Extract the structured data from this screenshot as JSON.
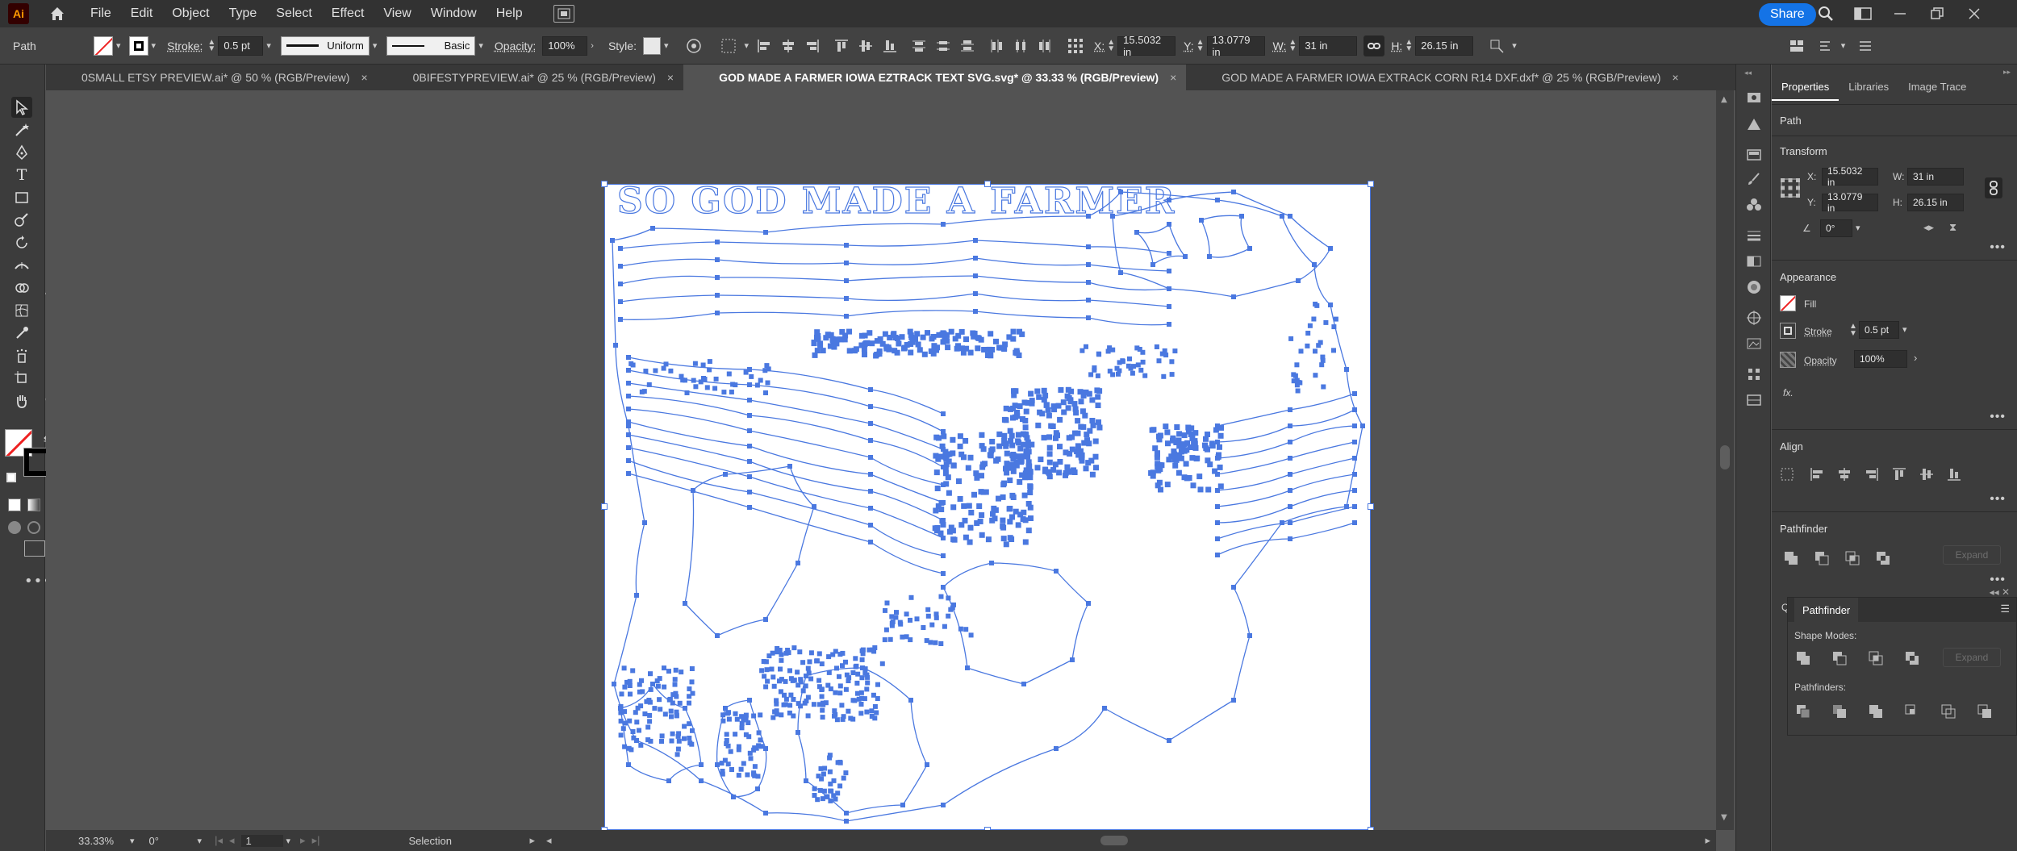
{
  "app": {
    "logo": "Ai",
    "menu": [
      "File",
      "Edit",
      "Object",
      "Type",
      "Select",
      "Effect",
      "View",
      "Window",
      "Help"
    ],
    "share_label": "Share"
  },
  "control_bar": {
    "object_type": "Path",
    "stroke_label": "Stroke:",
    "stroke_value": "0.5 pt",
    "stroke_profile": "Uniform",
    "brush": "Basic",
    "opacity_label": "Opacity:",
    "opacity_value": "100%",
    "style_label": "Style:",
    "x_label": "X:",
    "x_value": "15.5032 in",
    "y_label": "Y:",
    "y_value": "13.0779 in",
    "w_label": "W:",
    "w_value": "31 in",
    "h_label": "H:",
    "h_value": "26.15 in"
  },
  "tabs": [
    {
      "label": "0SMALL ETSY PREVIEW.ai* @ 50 % (RGB/Preview)",
      "active": false
    },
    {
      "label": "0BIFESTYPREVIEW.ai* @ 25 % (RGB/Preview)",
      "active": false
    },
    {
      "label": "GOD MADE A FARMER IOWA EZTRACK TEXT SVG.svg* @ 33.33 % (RGB/Preview)",
      "active": true
    },
    {
      "label": "GOD MADE A FARMER IOWA EXTRACK CORN R14 DXF.dxf* @ 25 % (RGB/Preview)",
      "active": false
    }
  ],
  "tab_close": "×",
  "artwork": {
    "headline": "SO GOD MADE A FARMER",
    "path_color": "#4a78e0"
  },
  "status_bar": {
    "zoom": "33.33%",
    "rotation": "0°",
    "artboard": "1",
    "tool": "Selection"
  },
  "properties": {
    "tabs": [
      "Properties",
      "Libraries",
      "Image Trace"
    ],
    "selection_type": "Path",
    "transform_title": "Transform",
    "x_label": "X:",
    "x_value": "15.5032 in",
    "y_label": "Y:",
    "y_value": "13.0779 in",
    "w_label": "W:",
    "w_value": "31 in",
    "h_label": "H:",
    "h_value": "26.15 in",
    "angle_value": "0°",
    "appearance_title": "Appearance",
    "fill_label": "Fill",
    "stroke_label": "Stroke",
    "stroke_value": "0.5 pt",
    "opacity_label": "Opacity",
    "opacity_value": "100%",
    "fx_label": "fx.",
    "align_title": "Align",
    "pathfinder_title": "Pathfinder",
    "expand_label": "Expand",
    "q_label": "Q"
  },
  "pathfinder_panel": {
    "title": "Pathfinder",
    "shape_modes_label": "Shape Modes:",
    "pathfinders_label": "Pathfinders:",
    "expand_label": "Expand"
  }
}
